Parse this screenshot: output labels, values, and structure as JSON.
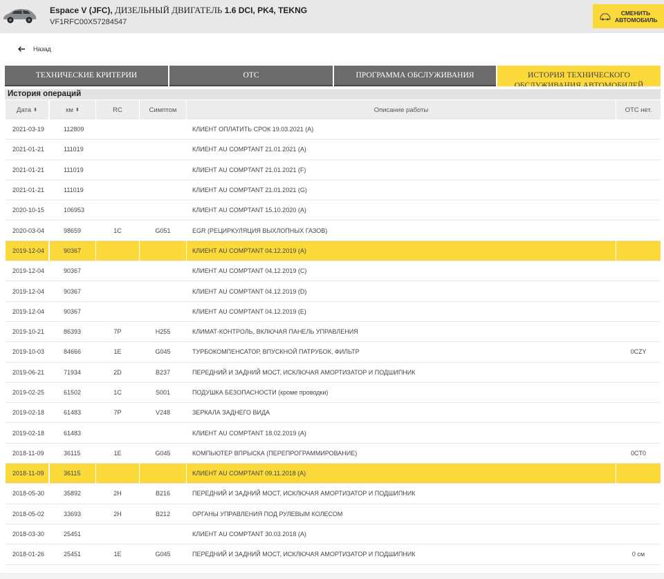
{
  "header": {
    "model": "Espace V (JFC),",
    "engine_label": " ДИЗЕЛЬНЫЙ ДВИГАТЕЛЬ",
    "engine_code": " 1.6 DCI, PK4, TEKNG",
    "vin": "VF1RFC00X57284547",
    "change_button_line1": "СМЕНИТЬ",
    "change_button_line2": "АВТОМОБИЛЬ",
    "accent_color": "#fcd93a"
  },
  "back_label": "Назад",
  "tabs": [
    {
      "label": "ТЕХНИЧЕСКИЕ КРИТЕРИИ",
      "active": false
    },
    {
      "label": "ОТС",
      "active": false
    },
    {
      "label": "ПРОГРАММА ОБСЛУЖИВАНИЯ",
      "active": false
    },
    {
      "label_line1": "ИСТОРИЯ ТЕХНИЧЕСКОГО",
      "label_line2": "ОБСЛУЖИВАНИЯ АВТОМОБИЛЕЙ",
      "active": true
    }
  ],
  "section_title": "История операций",
  "table": {
    "columns": {
      "date": "Дата",
      "km": "км",
      "rc": "RC",
      "symptom": "Симптом",
      "description": "Описание работы",
      "otc": "ОТС нет."
    },
    "sort_icon": "⬍",
    "rows": [
      {
        "date": "2021-03-19",
        "km": "112809",
        "rc": "",
        "symptom": "",
        "description": "КЛИЕНТ ОПЛАТИТЬ СРОК 19.03.2021 (A)",
        "otc": "",
        "highlighted": false
      },
      {
        "date": "2021-01-21",
        "km": "111019",
        "rc": "",
        "symptom": "",
        "description": "КЛИЕНТ AU COMPTANT 21.01.2021 (A)",
        "otc": "",
        "highlighted": false
      },
      {
        "date": "2021-01-21",
        "km": "111019",
        "rc": "",
        "symptom": "",
        "description": "КЛИЕНТ AU COMPTANT 21.01.2021 (F)",
        "otc": "",
        "highlighted": false
      },
      {
        "date": "2021-01-21",
        "km": "111019",
        "rc": "",
        "symptom": "",
        "description": "КЛИЕНТ AU COMPTANT 21.01.2021 (G)",
        "otc": "",
        "highlighted": false
      },
      {
        "date": "2020-10-15",
        "km": "106953",
        "rc": "",
        "symptom": "",
        "description": "КЛИЕНТ AU COMPTANT 15.10.2020 (A)",
        "otc": "",
        "highlighted": false
      },
      {
        "date": "2020-03-04",
        "km": "98659",
        "rc": "1C",
        "symptom": "G051",
        "description": "EGR (РЕЦИРКУЛЯЦИЯ ВЫХЛОПНЫХ ГАЗОВ)",
        "otc": "",
        "highlighted": false
      },
      {
        "date": "2019-12-04",
        "km": "90367",
        "rc": "",
        "symptom": "",
        "description": "КЛИЕНТ AU COMPTANT 04.12.2019 (A)",
        "otc": "",
        "highlighted": true
      },
      {
        "date": "2019-12-04",
        "km": "90367",
        "rc": "",
        "symptom": "",
        "description": "КЛИЕНТ AU COMPTANT 04.12.2019 (C)",
        "otc": "",
        "highlighted": false
      },
      {
        "date": "2019-12-04",
        "km": "90367",
        "rc": "",
        "symptom": "",
        "description": "КЛИЕНТ AU COMPTANT 04.12.2019 (D)",
        "otc": "",
        "highlighted": false
      },
      {
        "date": "2019-12-04",
        "km": "90367",
        "rc": "",
        "symptom": "",
        "description": "КЛИЕНТ AU COMPTANT 04.12.2019 (E)",
        "otc": "",
        "highlighted": false
      },
      {
        "date": "2019-10-21",
        "km": "86393",
        "rc": "7P",
        "symptom": "H255",
        "description": "КЛИМАТ-КОНТРОЛЬ, ВКЛЮЧАЯ ПАНЕЛЬ УПРАВЛЕНИЯ",
        "otc": "",
        "highlighted": false
      },
      {
        "date": "2019-10-03",
        "km": "84666",
        "rc": "1E",
        "symptom": "G045",
        "description": "ТУРБОКОМПЕНСАТОР, ВПУСКНОЙ ПАТРУБОК, ФИЛЬТР",
        "otc": "0CZY",
        "highlighted": false
      },
      {
        "date": "2019-06-21",
        "km": "71934",
        "rc": "2D",
        "symptom": "B237",
        "description": "ПЕРЕДНИЙ И ЗАДНИЙ МОСТ, ИСКЛЮЧАЯ АМОРТИЗАТОР И ПОДШИПНИК",
        "otc": "",
        "highlighted": false
      },
      {
        "date": "2019-02-25",
        "km": "61502",
        "rc": "1C",
        "symptom": "S001",
        "description": "ПОДУШКА БЕЗОПАСНОСТИ (кроме проводки)",
        "otc": "",
        "highlighted": false
      },
      {
        "date": "2019-02-18",
        "km": "61483",
        "rc": "7P",
        "symptom": "V248",
        "description": "ЗЕРКАЛА ЗАДНЕГО ВИДА",
        "otc": "",
        "highlighted": false
      },
      {
        "date": "2019-02-18",
        "km": "61483",
        "rc": "",
        "symptom": "",
        "description": "КЛИЕНТ AU COMPTANT 18.02.2019 (A)",
        "otc": "",
        "highlighted": false
      },
      {
        "date": "2018-11-09",
        "km": "36115",
        "rc": "1E",
        "symptom": "G045",
        "description": "КОМПЬЮТЕР ВПРЫСКА (ПЕРЕПРОГРАММИРОВАНИЕ)",
        "otc": "0CT0",
        "highlighted": false
      },
      {
        "date": "2018-11-09",
        "km": "36115",
        "rc": "",
        "symptom": "",
        "description": "КЛИЕНТ AU COMPTANT 09.11.2018 (A)",
        "otc": "",
        "highlighted": true
      },
      {
        "date": "2018-05-30",
        "km": "35892",
        "rc": "2H",
        "symptom": "B216",
        "description": "ПЕРЕДНИЙ И ЗАДНИЙ МОСТ, ИСКЛЮЧАЯ АМОРТИЗАТОР И ПОДШИПНИК",
        "otc": "",
        "highlighted": false
      },
      {
        "date": "2018-05-02",
        "km": "33693",
        "rc": "2H",
        "symptom": "B212",
        "description": "ОРГАНЫ УПРАВЛЕНИЯ ПОД РУЛЕВЫМ КОЛЕСОМ",
        "otc": "",
        "highlighted": false
      },
      {
        "date": "2018-03-30",
        "km": "25451",
        "rc": "",
        "symptom": "",
        "description": "КЛИЕНТ AU COMPTANT 30.03.2018 (A)",
        "otc": "",
        "highlighted": false
      },
      {
        "date": "2018-01-26",
        "km": "25451",
        "rc": "1E",
        "symptom": "G045",
        "description": "ПЕРЕДНИЙ И ЗАДНИЙ МОСТ, ИСКЛЮЧАЯ АМОРТИЗАТОР И ПОДШИПНИК",
        "otc": "0 см",
        "highlighted": false
      }
    ]
  }
}
